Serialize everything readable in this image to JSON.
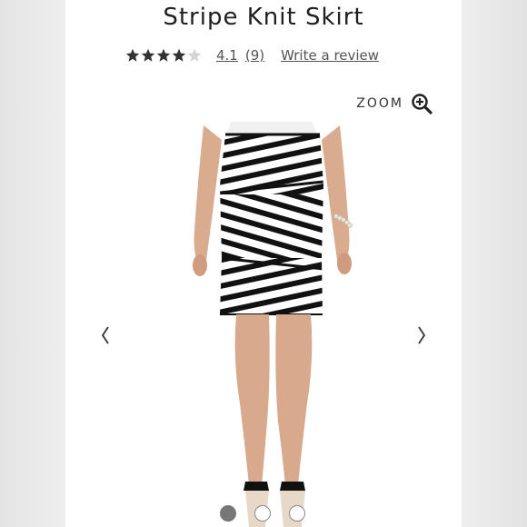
{
  "product": {
    "title": "Stripe Knit Skirt",
    "rating_value": "4.1",
    "review_count": "(9)",
    "write_review_label": "Write a review",
    "stars": [
      1,
      1,
      1,
      1,
      0.2
    ]
  },
  "gallery": {
    "zoom_label": "ZOOM",
    "slide_count": 3,
    "active_slide": 1
  },
  "colors": {
    "star_filled": "#333333",
    "star_empty": "#d4d4d4",
    "stripe_dark": "#111111",
    "stripe_light": "#ffffff"
  }
}
